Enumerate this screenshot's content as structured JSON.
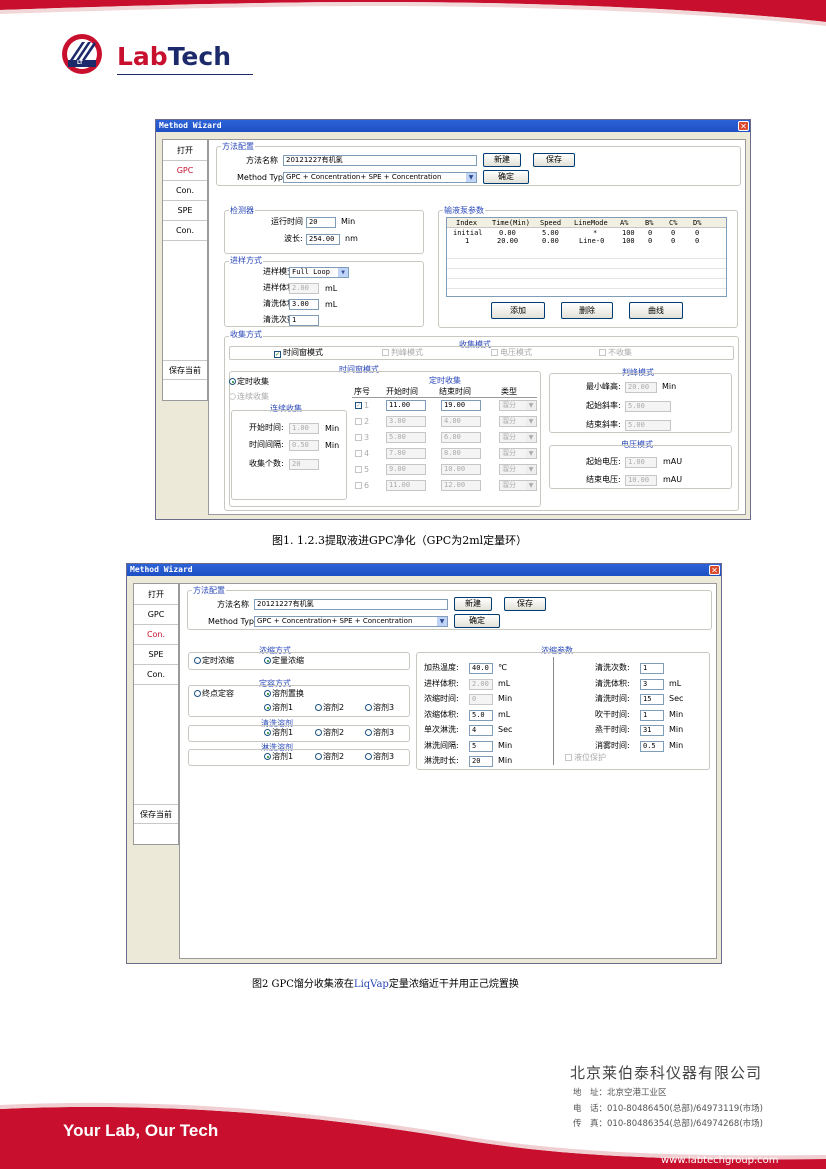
{
  "header": {
    "logo_lt": "LT",
    "brand_lab": "Lab",
    "brand_tech": "Tech"
  },
  "wiz1": {
    "title": "Method Wizard",
    "tabs": [
      "打开",
      "GPC",
      "Con.",
      "SPE",
      "Con.",
      "保存当前"
    ],
    "method": {
      "group": "方法配置",
      "name_label": "方法名称",
      "name_value": "20121227有机氯",
      "type_label": "Method Type:",
      "type_value": "GPC + Concentration+ SPE + Concentration",
      "new_button": "新建",
      "save_button": "保存",
      "ok_button": "确定"
    },
    "detector": {
      "group": "检测器",
      "runtime_label": "运行时间",
      "runtime_value": "20",
      "runtime_unit": "Min",
      "wavelength_label": "波长:",
      "wavelength_value": "254.00",
      "wavelength_unit": "nm"
    },
    "injection": {
      "group": "进样方式",
      "mode_label": "进样模式:",
      "mode_value": "Full Loop",
      "volume_label": "进样体积:",
      "volume_value": "2.00",
      "volume_unit": "mL",
      "wash_vol_label": "清洗体积:",
      "wash_vol_value": "3.00",
      "wash_vol_unit": "mL",
      "wash_count_label": "清洗次数:",
      "wash_count_value": "1"
    },
    "pump": {
      "group": "输液泵参数",
      "columns": [
        "Index",
        "Time(Min)",
        "Speed",
        "LineMode",
        "A%",
        "B%",
        "C%",
        "D%"
      ],
      "rows": [
        [
          "initial",
          "0.00",
          "5.00",
          "*",
          "100",
          "0",
          "0",
          "0"
        ],
        [
          "1",
          "20.00",
          "0.00",
          "Line-0",
          "100",
          "0",
          "0",
          "0"
        ]
      ],
      "add_button": "添加",
      "delete_button": "删除",
      "curve_button": "曲线"
    },
    "collect": {
      "group": "收集方式",
      "mode_title": "收集模式",
      "modes": [
        "时间窗模式",
        "判峰模式",
        "电压模式",
        "不收集"
      ],
      "window_title": "时间窗模式",
      "timed_radio": "定时收集",
      "continuous_radio": "连续收集",
      "continuous_group": "连续收集",
      "start_label": "开始时间:",
      "start_value": "1.00",
      "start_unit": "Min",
      "interval_label": "时间间隔:",
      "interval_value": "0.50",
      "interval_unit": "Min",
      "count_label": "收集个数:",
      "count_value": "20",
      "timed_title": "定时收集",
      "cols": [
        "序号",
        "开始时间",
        "结束时间",
        "类型"
      ],
      "rows": [
        [
          "1",
          "11.00",
          "19.00",
          "溜分"
        ],
        [
          "2",
          "3.00",
          "4.00",
          "溜分"
        ],
        [
          "3",
          "5.00",
          "6.00",
          "溜分"
        ],
        [
          "4",
          "7.00",
          "8.00",
          "溜分"
        ],
        [
          "5",
          "9.00",
          "10.00",
          "溜分"
        ],
        [
          "6",
          "11.00",
          "12.00",
          "溜分"
        ]
      ],
      "peak_title": "判峰模式",
      "min_peak_label": "最小峰高:",
      "min_peak_value": "20.00",
      "min_peak_unit": "Min",
      "start_slope_label": "起始斜率:",
      "start_slope_value": "5.00",
      "end_slope_label": "结束斜率:",
      "end_slope_value": "5.00",
      "volt_title": "电压模式",
      "start_volt_label": "起始电压:",
      "start_volt_value": "1.00",
      "end_volt_label": "结束电压:",
      "end_volt_value": "10.00",
      "volt_unit": "mAU"
    }
  },
  "caption1": "图1. 1.2.3提取液进GPC净化（GPC为2ml定量环）",
  "wiz2": {
    "title": "Method Wizard",
    "tabs": [
      "打开",
      "GPC",
      "Con.",
      "SPE",
      "Con.",
      "保存当前"
    ],
    "method": {
      "group": "方法配置",
      "name_label": "方法名称",
      "name_value": "20121227有机氯",
      "type_label": "Method Type:",
      "type_value": "GPC + Concentration+ SPE + Concentration",
      "new_button": "新建",
      "save_button": "保存",
      "ok_button": "确定"
    },
    "conc_mode": {
      "title": "浓缩方式",
      "timed": "定时浓缩",
      "quant": "定量浓缩"
    },
    "volume_mode": {
      "title": "定容方式",
      "endpoint": "终点定容",
      "solvent_swap": "溶剂置换",
      "s1": "溶剂1",
      "s2": "溶剂2",
      "s3": "溶剂3"
    },
    "wash_solvent": {
      "title": "清洗溶剂",
      "s1": "溶剂1",
      "s2": "溶剂2",
      "s3": "溶剂3"
    },
    "rinse_solvent": {
      "title": "淋洗溶剂",
      "s1": "溶剂1",
      "s2": "溶剂2",
      "s3": "溶剂3"
    },
    "params": {
      "title": "浓缩参数",
      "left": [
        {
          "label": "加热温度:",
          "value": "40.0",
          "unit": "℃"
        },
        {
          "label": "进样体积:",
          "value": "2.00",
          "unit": "mL"
        },
        {
          "label": "浓缩时间:",
          "value": "0",
          "unit": "Min"
        },
        {
          "label": "浓缩体积:",
          "value": "5.0",
          "unit": "mL"
        },
        {
          "label": "单次淋洗:",
          "value": "4",
          "unit": "Sec"
        },
        {
          "label": "淋洗间隔:",
          "value": "5",
          "unit": "Min"
        },
        {
          "label": "淋洗时长:",
          "value": "20",
          "unit": "Min"
        }
      ],
      "right": [
        {
          "label": "清洗次数:",
          "value": "1",
          "unit": ""
        },
        {
          "label": "清洗体积:",
          "value": "3",
          "unit": "mL"
        },
        {
          "label": "清洗时间:",
          "value": "15",
          "unit": "Sec"
        },
        {
          "label": "吹干时间:",
          "value": "1",
          "unit": "Min"
        },
        {
          "label": "烝干时间:",
          "value": "31",
          "unit": "Min"
        },
        {
          "label": "消雾时间:",
          "value": "0.5",
          "unit": "Min"
        }
      ],
      "level_protect": "液位保护"
    }
  },
  "caption2": {
    "before": "图2 GPC馏分收集液在",
    "link": "LiqVap",
    "after": "定量浓缩近干并用正己烷置换"
  },
  "company": {
    "name": "北京莱伯泰科仪器有限公司",
    "address": "地　址：北京空港工业区",
    "phone": "电　话：010-80486450(总部)/64973119(市场)",
    "fax": "传　真：010-80486354(总部)/64974268(市场)"
  },
  "footer": {
    "slogan": "Your Lab,  Our Tech",
    "website": "www.labtechgroup.com"
  },
  "colors": {
    "brand_red": "#c8102e",
    "brand_navy": "#1c2a6b",
    "accent_blue": "#2a48b8"
  }
}
